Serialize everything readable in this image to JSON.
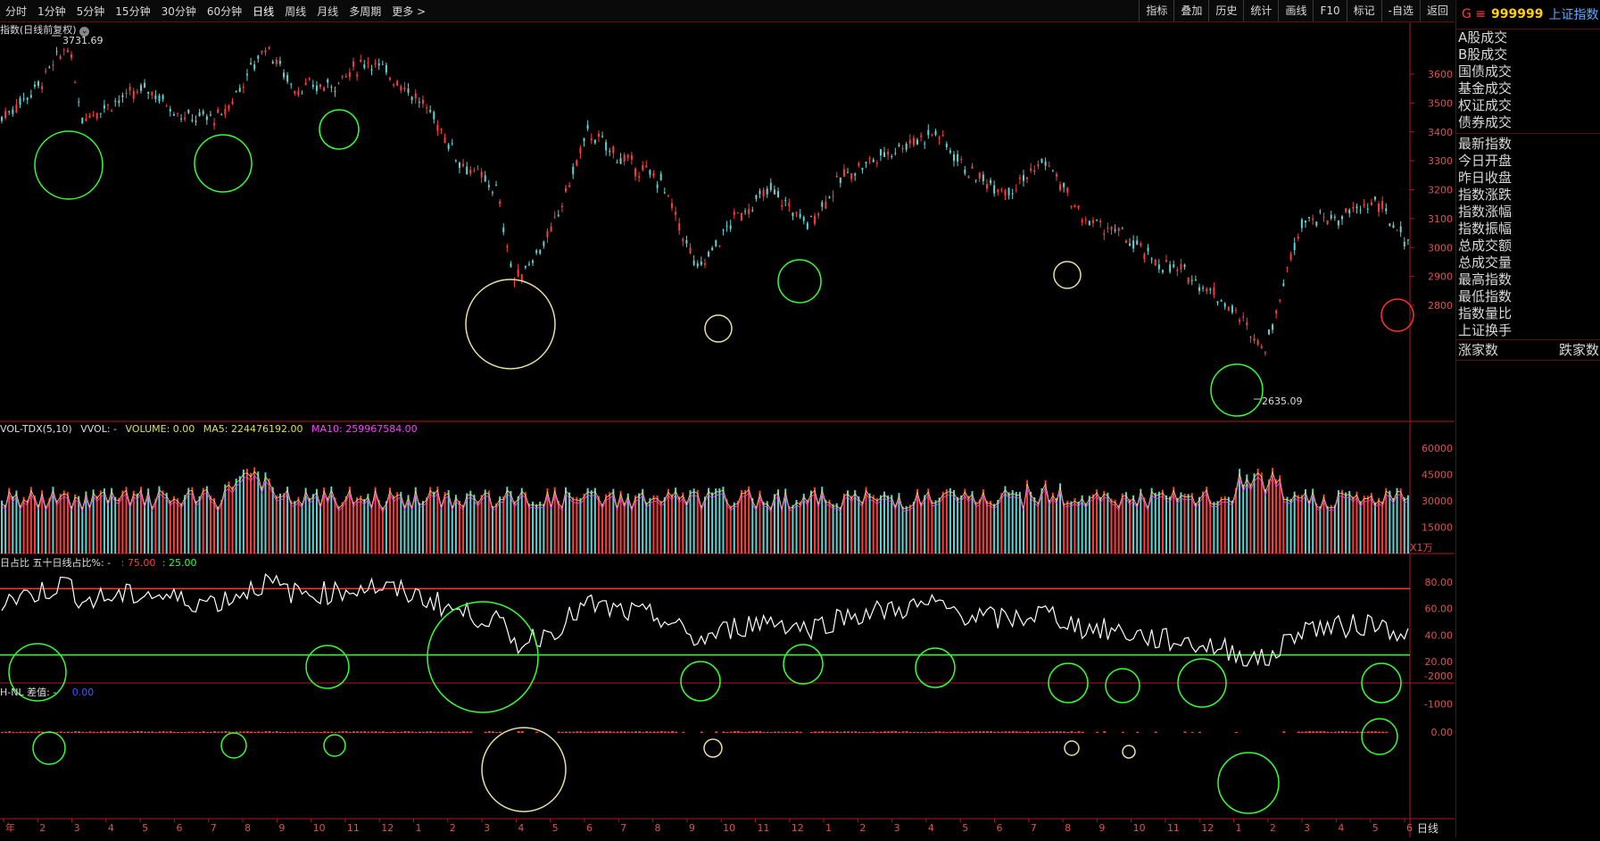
{
  "toolbar": {
    "periods": [
      "分时",
      "1分钟",
      "5分钟",
      "15分钟",
      "30分钟",
      "60分钟",
      "日线",
      "周线",
      "月线",
      "多周期",
      "更多 >"
    ],
    "active_period": "日线",
    "right_buttons": [
      "指标",
      "叠加",
      "历史",
      "统计",
      "画线",
      "F10",
      "标记",
      "-自选",
      "返回"
    ]
  },
  "main_chart": {
    "title": "指数(日线前复权)",
    "high_label": "3731.69",
    "low_label": "2635.09",
    "y_ticks": [
      "3600",
      "3500",
      "3400",
      "3300",
      "3200",
      "3100",
      "3000",
      "2900",
      "2800"
    ]
  },
  "volume_panel": {
    "title_prefix": "VOL-TDX(5,10)",
    "vvol": "VVOL: -",
    "volume": "VOLUME: 0.00",
    "ma5": "MA5: 224476192.00",
    "ma10": "MA10: 259967584.00",
    "y_ticks": [
      "60000",
      "45000",
      "30000",
      "15000"
    ],
    "unit": "X1万"
  },
  "ratio_panel": {
    "title": "日占比 五十日线占比%: -",
    "upper": ": 75.00",
    "lower": ": 25.00",
    "y_ticks": [
      "80.00",
      "60.00",
      "40.00",
      "20.00"
    ]
  },
  "nhnl_panel": {
    "title": "H-NL 差值: -",
    "value": "0.00",
    "y_ticks": [
      "0.00",
      "-1000",
      "-2000"
    ]
  },
  "x_axis": {
    "labels": [
      "年",
      "2",
      "3",
      "4",
      "5",
      "6",
      "7",
      "8",
      "9",
      "10",
      "11",
      "12",
      "1",
      "2",
      "3",
      "4",
      "5",
      "6",
      "7",
      "8",
      "9",
      "10",
      "11",
      "12",
      "1",
      "2",
      "3",
      "4",
      "5",
      "6",
      "7",
      "8",
      "9",
      "10",
      "11",
      "12",
      "1",
      "2",
      "3",
      "4",
      "5",
      "6"
    ],
    "period_label": "日线"
  },
  "right_panel": {
    "code_prefix": "G ≡",
    "code": "999999",
    "name": "上证指数",
    "items_top": [
      "A股成交",
      "B股成交",
      "国债成交",
      "基金成交",
      "权证成交",
      "债券成交"
    ],
    "items_mid": [
      "最新指数",
      "今日开盘",
      "昨日收盘",
      "指数涨跌",
      "指数涨幅",
      "指数振幅",
      "总成交额",
      "总成交量",
      "最高指数",
      "最低指数",
      "指数量比",
      "上证换手"
    ],
    "rise": "涨家数",
    "fall": "跌家数"
  },
  "colors": {
    "up": "#ff3b3b",
    "down": "#5fd3d3",
    "green": "#33ff33",
    "axis": "#b01818",
    "ma5": "#e0e040",
    "ma10": "#ff40ff"
  }
}
